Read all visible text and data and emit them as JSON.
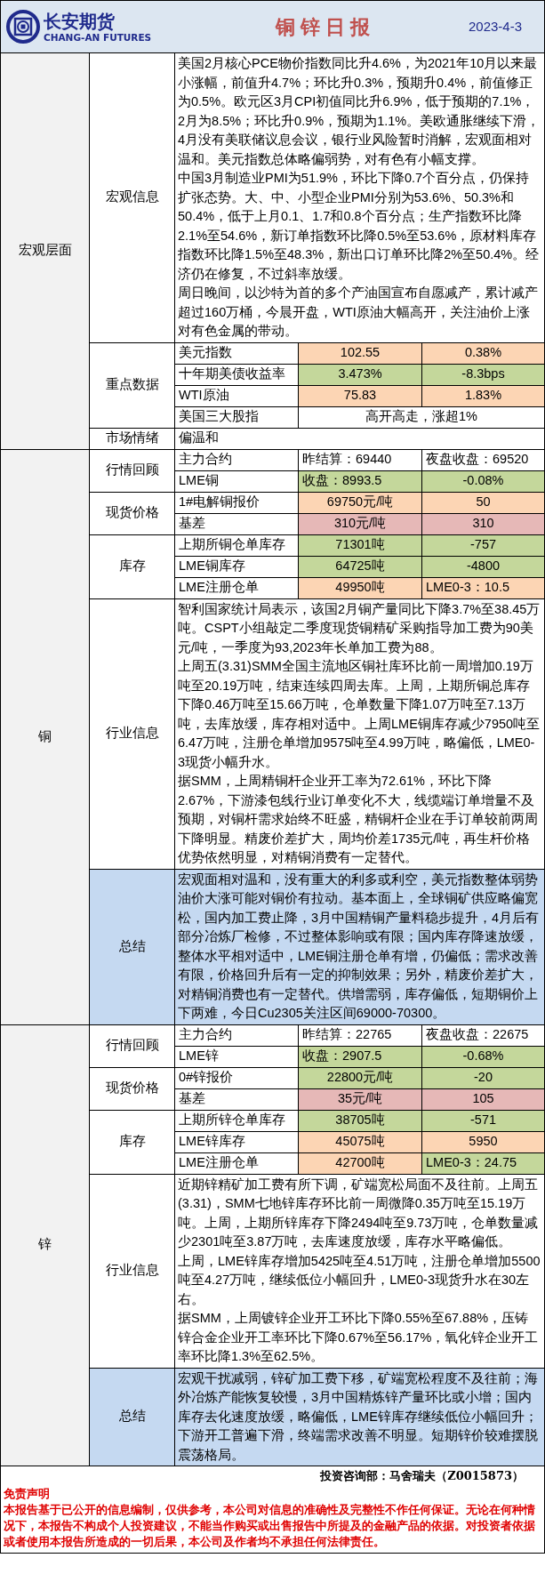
{
  "header": {
    "logo_cn": "长安期货",
    "logo_en": "CHANG-AN FUTURES",
    "title": "铜 锌 日 报",
    "date": "2023-4-3"
  },
  "sections": [
    {
      "label": "宏观层面",
      "groups": [
        {
          "label": "宏观信息",
          "kind": "text",
          "paragraphs": [
            "美国2月核心PCE物价指数同比升4.6%，为2021年10月以来最小涨幅，前值升4.7%；环比升0.3%，预期升0.4%，前值修正为0.5%。欧元区3月CPI初值同比升6.9%，低于预期的7.1%，2月为8.5%；环比升0.9%，预期为1.1%。美欧通胀继续下滑，4月没有美联储议息会议，银行业风险暂时消解，宏观面相对温和。美元指数总体略偏弱势，对有色有小幅支撑。",
            "中国3月制造业PMI为51.9%，环比下降0.7个百分点，仍保持扩张态势。大、中、小型企业PMI分别为53.6%、50.3%和50.4%，低于上月0.1、1.7和0.8个百分点；生产指数环比降2.1%至54.6%，新订单指数环比降0.5%至53.6%，原材料库存指数环比降1.5%至48.3%，新出口订单环比降2%至50.4%。经济仍在修复，不过斜率放缓。",
            "周日晚间，以沙特为首的多个产油国宣布自愿减产，累计减产超过160万桶，今晨开盘，WTI原油大幅高开，关注油价上涨对有色金属的带动。"
          ]
        },
        {
          "label": "重点数据",
          "kind": "table",
          "rows": [
            {
              "cells": [
                {
                  "text": "美元指数"
                },
                {
                  "text": "102.55",
                  "color": "#fcd5b4"
                },
                {
                  "text": "0.38%",
                  "color": "#fcd5b4"
                }
              ]
            },
            {
              "cells": [
                {
                  "text": "十年期美债收益率"
                },
                {
                  "text": "3.473%",
                  "color": "#c4d79b"
                },
                {
                  "text": "-8.3bps",
                  "color": "#c4d79b"
                }
              ]
            },
            {
              "cells": [
                {
                  "text": "WTI原油"
                },
                {
                  "text": "75.83",
                  "color": "#fcd5b4"
                },
                {
                  "text": "1.83%",
                  "color": "#fcd5b4"
                }
              ]
            },
            {
              "cells": [
                {
                  "text": "美国三大股指"
                },
                {
                  "text": "高开高走，涨超1%"
                }
              ]
            }
          ]
        },
        {
          "label": "市场情绪",
          "kind": "table",
          "rows": [
            {
              "cells": [
                {
                  "text": "偏温和"
                }
              ]
            }
          ]
        }
      ]
    },
    {
      "label": "铜",
      "groups": [
        {
          "label": "行情回顾",
          "kind": "table",
          "rows": [
            {
              "cells": [
                {
                  "text": "主力合约"
                },
                {
                  "text": "昨结算：69440",
                  "kind": "labeled"
                },
                {
                  "text": "夜盘收盘：69520",
                  "kind": "labeled"
                }
              ]
            },
            {
              "cells": [
                {
                  "text": "LME铜"
                },
                {
                  "text": "收盘：8993.5",
                  "color": "#c4d79b",
                  "kind": "labeled"
                },
                {
                  "text": "-0.08%",
                  "color": "#c4d79b"
                }
              ]
            }
          ]
        },
        {
          "label": "现货价格",
          "kind": "table",
          "rows": [
            {
              "cells": [
                {
                  "text": "1#电解铜报价"
                },
                {
                  "text": "69750元/吨",
                  "color": "#fcd5b4"
                },
                {
                  "text": "50",
                  "color": "#fcd5b4"
                }
              ]
            },
            {
              "cells": [
                {
                  "text": "基差"
                },
                {
                  "text": "310元/吨",
                  "color": "#e6b8b7"
                },
                {
                  "text": "310",
                  "color": "#e6b8b7"
                }
              ]
            }
          ]
        },
        {
          "label": "库存",
          "kind": "table",
          "rows": [
            {
              "cells": [
                {
                  "text": "上期所铜仓单库存"
                },
                {
                  "text": "71301吨",
                  "color": "#c4d79b"
                },
                {
                  "text": "-757",
                  "color": "#c4d79b"
                }
              ]
            },
            {
              "cells": [
                {
                  "text": "LME铜库存"
                },
                {
                  "text": "64725吨",
                  "color": "#c4d79b"
                },
                {
                  "text": "-4800",
                  "color": "#c4d79b"
                }
              ]
            },
            {
              "cells": [
                {
                  "text": "LME注册仓单"
                },
                {
                  "text": "49950吨",
                  "color": "#fcd5b4"
                },
                {
                  "text": "LME0-3：10.5",
                  "color": "#fcd5b4",
                  "kind": "labeled"
                }
              ]
            }
          ]
        },
        {
          "label": "行业信息",
          "kind": "text",
          "paragraphs": [
            "智利国家统计局表示，该国2月铜产量同比下降3.7%至38.45万吨。CSPT小组敲定二季度现货铜精矿采购指导加工费为90美元/吨，一季度为93,2023年长单加工费为88。",
            "上周五(3.31)SMM全国主流地区铜社库环比前一周增加0.19万吨至20.19万吨，结束连续四周去库。上周，上期所铜总库存下降0.46万吨至15.66万吨，仓单数量下降1.07万吨至7.13万吨，去库放缓，库存相对适中。上周LME铜库存减少7950吨至6.47万吨，注册仓单增加9575吨至4.99万吨，略偏低，LME0-3现货小幅升水。",
            "据SMM，上周精铜杆企业开工率为72.61%，环比下降2.67%，下游漆包线行业订单变化不大，线缆端订单增量不及预期，对铜杆需求始终不旺盛，精铜杆企业在手订单较前两周下降明显。精废价差扩大，周均价差1735元/吨，再生杆价格优势依然明显，对精铜消费有一定替代。"
          ]
        },
        {
          "label": "总结",
          "kind": "summary",
          "paragraphs": [
            "宏观面相对温和，没有重大的利多或利空，美元指数整体弱势油价大涨可能对铜价有拉动。基本面上，全球铜矿供应略偏宽松，国内加工费止降，3月中国精铜产量料稳步提升，4月后有部分冶炼厂检修，不过整体影响或有限；国内库存降速放缓，整体水平相对适中，LME铜注册仓单有增，仍偏低；需求改善有限，价格回升后有一定的抑制效果；另外，精废价差扩大，对精铜消费也有一定替代。供增需弱，库存偏低，短期铜价上下两难，今日Cu2305关注区间69000-70300。"
          ]
        }
      ]
    },
    {
      "label": "锌",
      "groups": [
        {
          "label": "行情回顾",
          "kind": "table",
          "rows": [
            {
              "cells": [
                {
                  "text": "主力合约"
                },
                {
                  "text": "昨结算：22765",
                  "kind": "labeled"
                },
                {
                  "text": "夜盘收盘：22675",
                  "kind": "labeled"
                }
              ]
            },
            {
              "cells": [
                {
                  "text": "LME锌"
                },
                {
                  "text": "收盘：2907.5",
                  "color": "#c4d79b",
                  "kind": "labeled"
                },
                {
                  "text": "-0.68%",
                  "color": "#c4d79b"
                }
              ]
            }
          ]
        },
        {
          "label": "现货价格",
          "kind": "table",
          "rows": [
            {
              "cells": [
                {
                  "text": "0#锌报价"
                },
                {
                  "text": "22800元/吨",
                  "color": "#c4d79b"
                },
                {
                  "text": "-20",
                  "color": "#c4d79b"
                }
              ]
            },
            {
              "cells": [
                {
                  "text": "基差"
                },
                {
                  "text": "35元/吨",
                  "color": "#e6b8b7"
                },
                {
                  "text": "105",
                  "color": "#e6b8b7"
                }
              ]
            }
          ]
        },
        {
          "label": "库存",
          "kind": "table",
          "rows": [
            {
              "cells": [
                {
                  "text": "上期所锌仓单库存"
                },
                {
                  "text": "38705吨",
                  "color": "#c4d79b"
                },
                {
                  "text": "-571",
                  "color": "#c4d79b"
                }
              ]
            },
            {
              "cells": [
                {
                  "text": "LME锌库存"
                },
                {
                  "text": "45075吨",
                  "color": "#fcd5b4"
                },
                {
                  "text": "5950",
                  "color": "#fcd5b4"
                }
              ]
            },
            {
              "cells": [
                {
                  "text": "LME注册仓单"
                },
                {
                  "text": "42700吨",
                  "color": "#fcd5b4"
                },
                {
                  "text": "LME0-3：24.75",
                  "color": "#c4d79b",
                  "kind": "labeled"
                }
              ]
            }
          ]
        },
        {
          "label": "行业信息",
          "kind": "text",
          "paragraphs": [
            "近期锌精矿加工费有所下调，矿端宽松局面不及往前。上周五(3.31)，SMM七地锌库存环比前一周微降0.35万吨至15.19万吨。上周，上期所锌库存下降2494吨至9.73万吨，仓单数量减少2301吨至3.87万吨，去库速度放缓，库存水平略偏低。",
            "上周，LME锌库存增加5425吨至4.51万吨，注册仓单增加5500吨至4.27万吨，继续低位小幅回升，LME0-3现货升水在30左右。",
            "据SMM，上周镀锌企业开工环比下降0.55%至67.88%，压铸锌合金企业开工率环比下降0.67%至56.17%，氧化锌企业开工率环比降1.3%至62.5%。"
          ]
        },
        {
          "label": "总结",
          "kind": "summary",
          "paragraphs": [
            "宏观干扰减弱，锌矿加工费下移，矿端宽松程度不及往前；海外冶炼产能恢复较慢，3月中国精炼锌产量环比或小增；国内库存去化速度放缓，略偏低，LME锌库存继续低位小幅回升；下游开工普遍下滑，终端需求改善不明显。短期锌价较难摆脱震荡格局。"
          ]
        }
      ]
    }
  ],
  "footer": {
    "author": "投资咨询部：马舍瑞夫（Z0015873）",
    "disclaimer_title": "免责声明",
    "disclaimer": "本报告基于已公开的信息编制，仅供参考，本公司对信息的准确性及完整性不作任何保证。无论在何种情况下，本报告不构成个人投资建议，不能当作购买或出售报告中所提及的金融产品的依据。对投资者依据或者使用本报告所造成的一切后果，本公司及作者均不承担任何法律责任。"
  }
}
